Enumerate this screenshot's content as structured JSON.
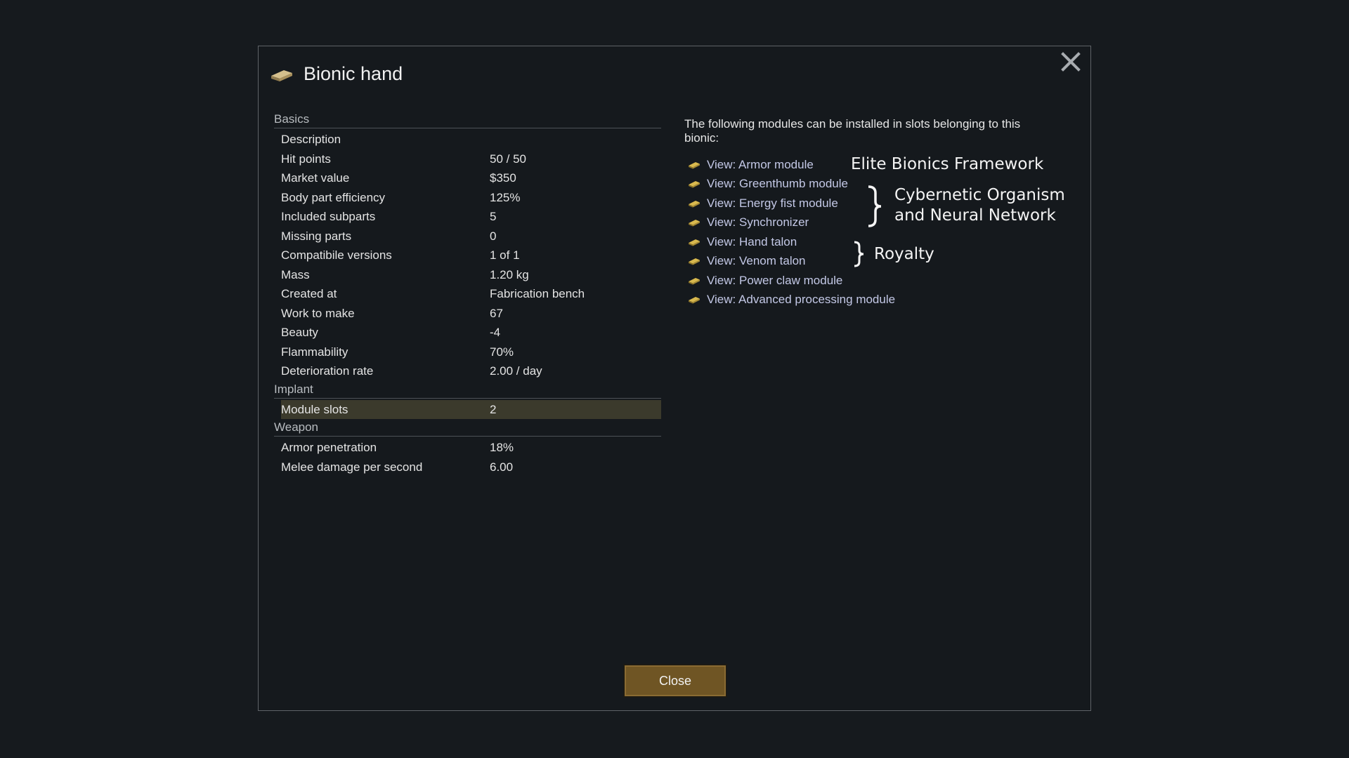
{
  "dialog": {
    "title": "Bionic hand",
    "close_button_label": "Close",
    "icons": {
      "title": "bionic-part-icon",
      "close": "close-icon"
    }
  },
  "stats": {
    "sections": [
      {
        "header": "Basics",
        "rows": [
          {
            "label": "Description",
            "value": ""
          },
          {
            "label": "Hit points",
            "value": "50 / 50"
          },
          {
            "label": "Market value",
            "value": "$350"
          },
          {
            "label": "Body part efficiency",
            "value": "125%"
          },
          {
            "label": "Included subparts",
            "value": "5"
          },
          {
            "label": "Missing parts",
            "value": "0"
          },
          {
            "label": "Compatibile versions",
            "value": "1 of 1"
          },
          {
            "label": "Mass",
            "value": "1.20 kg"
          },
          {
            "label": "Created at",
            "value": "Fabrication bench"
          },
          {
            "label": "Work to make",
            "value": "67"
          },
          {
            "label": "Beauty",
            "value": "-4"
          },
          {
            "label": "Flammability",
            "value": "70%"
          },
          {
            "label": "Deterioration rate",
            "value": "2.00 / day"
          }
        ]
      },
      {
        "header": "Implant",
        "rows": [
          {
            "label": "Module slots",
            "value": "2",
            "highlighted": true
          }
        ]
      },
      {
        "header": "Weapon",
        "rows": [
          {
            "label": "Armor penetration",
            "value": "18%"
          },
          {
            "label": "Melee damage per second",
            "value": "6.00"
          }
        ]
      }
    ]
  },
  "modules": {
    "intro": "The following modules can be installed in slots belonging to this bionic:",
    "items": [
      "View: Armor module",
      "View: Greenthumb module",
      "View: Energy fist module",
      "View: Synchronizer",
      "View: Hand talon",
      "View: Venom talon",
      "View: Power claw module",
      "View: Advanced processing module"
    ]
  },
  "annotations": {
    "elite": "Elite Bionics Framework",
    "cyber_line1": "Cybernetic Organism",
    "cyber_line2": "and Neural Network",
    "royalty": "Royalty"
  },
  "colors": {
    "background": "#161a1e",
    "link": "#c3c8e6",
    "highlight_row": "#3b3a2c",
    "button": "#6f5524"
  }
}
